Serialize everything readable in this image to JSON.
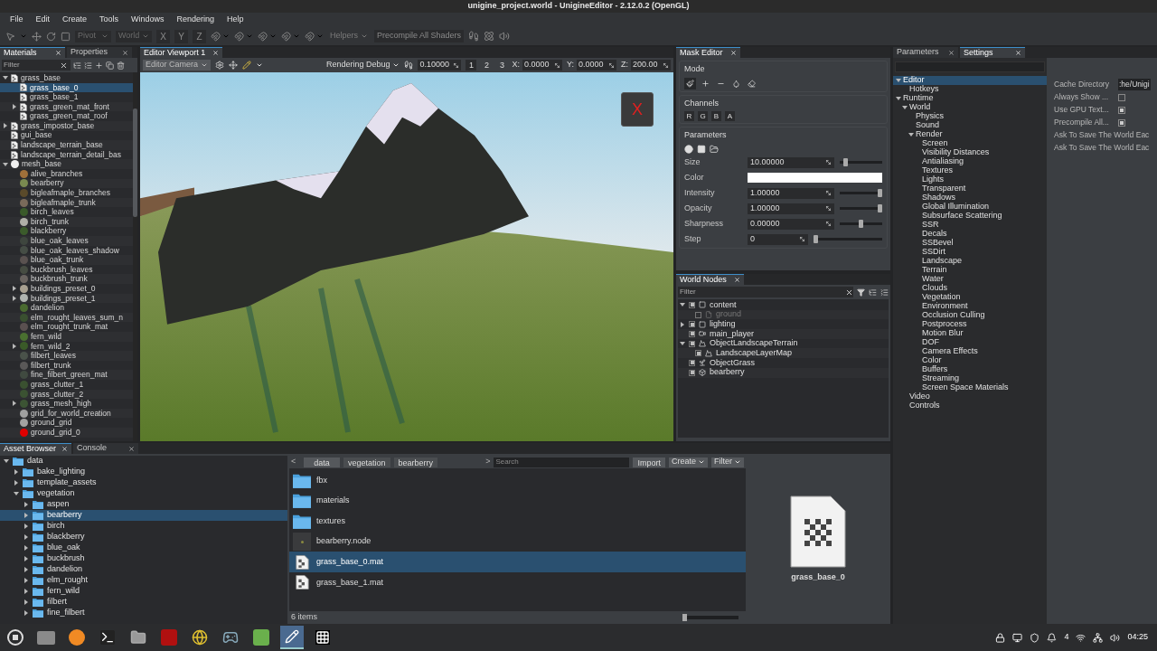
{
  "window": {
    "title": "unigine_project.world - UnigineEditor - 2.12.0.2 (OpenGL)"
  },
  "menu": [
    "File",
    "Edit",
    "Create",
    "Tools",
    "Windows",
    "Rendering",
    "Help"
  ],
  "toolbar": {
    "pivot": "Pivot",
    "space": "World",
    "axes": [
      "X",
      "Y",
      "Z"
    ],
    "helpers": "Helpers",
    "precompile": "Precompile All Shaders"
  },
  "materials": {
    "tabs": [
      {
        "label": "Materials",
        "selected": true
      },
      {
        "label": "Properties",
        "selected": false
      }
    ],
    "filter_placeholder": "Filter",
    "items": [
      {
        "label": "grass_base",
        "kind": "doc",
        "selected": false,
        "expanded": true,
        "children": [
          {
            "label": "grass_base_0",
            "kind": "doc",
            "selected": true
          },
          {
            "label": "grass_base_1",
            "kind": "doc",
            "selected": false
          },
          {
            "label": "grass_green_mat_front",
            "kind": "doc",
            "selected": false,
            "expanded": false
          },
          {
            "label": "grass_green_mat_roof",
            "kind": "doc",
            "selected": false
          }
        ]
      },
      {
        "label": "grass_impostor_base",
        "kind": "doc",
        "selected": false,
        "expanded": false
      },
      {
        "label": "gui_base",
        "kind": "doc",
        "selected": false
      },
      {
        "label": "landscape_terrain_base",
        "kind": "doc",
        "selected": false
      },
      {
        "label": "landscape_terrain_detail_bas",
        "kind": "doc",
        "selected": false
      },
      {
        "label": "mesh_base",
        "kind": "sphere",
        "color": "#f0f0f0",
        "selected": false,
        "expanded": true,
        "children": [
          {
            "label": "alive_branches",
            "kind": "sphere",
            "color": "#a0703a",
            "selected": false
          },
          {
            "label": "bearberry",
            "kind": "sphere",
            "color": "#7a8a50",
            "selected": false
          },
          {
            "label": "bigleafmaple_branches",
            "kind": "sphere",
            "color": "#5a4a2a",
            "selected": false
          },
          {
            "label": "bigleafmaple_trunk",
            "kind": "sphere",
            "color": "#7a6a5a",
            "selected": false
          },
          {
            "label": "birch_leaves",
            "kind": "sphere",
            "color": "#3a5a2a",
            "selected": false
          },
          {
            "label": "birch_trunk",
            "kind": "sphere",
            "color": "#b0b0a8",
            "selected": false
          },
          {
            "label": "blackberry",
            "kind": "sphere",
            "color": "#3b5b2b",
            "selected": false
          },
          {
            "label": "blue_oak_leaves",
            "kind": "sphere",
            "color": "#3e463e",
            "selected": false
          },
          {
            "label": "blue_oak_leaves_shadow",
            "kind": "sphere",
            "color": "#454d45",
            "selected": false
          },
          {
            "label": "blue_oak_trunk",
            "kind": "sphere",
            "color": "#5a5250",
            "selected": false
          },
          {
            "label": "buckbrush_leaves",
            "kind": "sphere",
            "color": "#464c42",
            "selected": false
          },
          {
            "label": "buckbrush_trunk",
            "kind": "sphere",
            "color": "#6a6460",
            "selected": false
          },
          {
            "label": "buildings_preset_0",
            "kind": "sphere",
            "color": "#a8a090",
            "selected": false,
            "expanded": false
          },
          {
            "label": "buildings_preset_1",
            "kind": "sphere",
            "color": "#b0b4b0",
            "selected": false,
            "expanded": false
          },
          {
            "label": "dandelion",
            "kind": "sphere",
            "color": "#4a6a30",
            "selected": false
          },
          {
            "label": "elm_rought_leaves_sum_n",
            "kind": "sphere",
            "color": "#3a5030",
            "selected": false
          },
          {
            "label": "elm_rought_trunk_mat",
            "kind": "sphere",
            "color": "#5a5050",
            "selected": false
          },
          {
            "label": "fern_wild",
            "kind": "sphere",
            "color": "#4a7030",
            "selected": false
          },
          {
            "label": "fern_wild_2",
            "kind": "sphere",
            "color": "#3a5a28",
            "selected": false,
            "expanded": false
          },
          {
            "label": "filbert_leaves",
            "kind": "sphere",
            "color": "#4a524a",
            "selected": false
          },
          {
            "label": "filbert_trunk",
            "kind": "sphere",
            "color": "#5a5858",
            "selected": false
          },
          {
            "label": "fine_filbert_green_mat",
            "kind": "sphere",
            "color": "#404a40",
            "selected": false
          },
          {
            "label": "grass_clutter_1",
            "kind": "sphere",
            "color": "#3a5030",
            "selected": false
          },
          {
            "label": "grass_clutter_2",
            "kind": "sphere",
            "color": "#3b5232",
            "selected": false
          },
          {
            "label": "grass_mesh_high",
            "kind": "sphere",
            "color": "#3c5434",
            "selected": false,
            "expanded": false
          },
          {
            "label": "grid_for_world_creation",
            "kind": "sphere",
            "color": "#a0a0a0",
            "selected": false
          },
          {
            "label": "ground_grid",
            "kind": "sphere",
            "color": "#a2a2a2",
            "selected": false
          },
          {
            "label": "ground_grid_0",
            "kind": "sphere",
            "color": "#e00000",
            "selected": false
          }
        ]
      }
    ]
  },
  "viewport": {
    "tab": "Editor Viewport 1",
    "camera": "Editor Camera",
    "rendering": "Rendering Debug",
    "speed": "0.10000",
    "presets": [
      "1",
      "2",
      "3"
    ],
    "coords": [
      {
        "label": "X:",
        "value": "0.0000"
      },
      {
        "label": "Y:",
        "value": "0.0000"
      },
      {
        "label": "Z:",
        "value": "200.00"
      }
    ],
    "gizmo_label": "X"
  },
  "mask_editor": {
    "tab": "Mask Editor",
    "mode_title": "Mode",
    "modes": [
      {
        "kind": "brush",
        "selected": true
      },
      {
        "kind": "add",
        "selected": false
      },
      {
        "kind": "subtract",
        "selected": false
      },
      {
        "kind": "drop",
        "selected": false
      },
      {
        "kind": "eraser",
        "selected": false
      }
    ],
    "channels_title": "Channels",
    "channels": [
      "R",
      "G",
      "B",
      "A"
    ],
    "parameters_title": "Parameters",
    "params": [
      {
        "kind": "number",
        "label": "Size",
        "value": "10.00000",
        "level": 0.1
      },
      {
        "kind": "color",
        "label": "Color",
        "color": "#ffffff"
      },
      {
        "kind": "number",
        "label": "Intensity",
        "value": "1.00000",
        "level": 1
      },
      {
        "kind": "number",
        "label": "Opacity",
        "value": "1.00000",
        "level": 1
      },
      {
        "kind": "number",
        "label": "Sharpness",
        "value": "0.00000",
        "level": 0.5
      },
      {
        "kind": "integer",
        "label": "Step",
        "value": "0",
        "level": 0
      }
    ]
  },
  "world_nodes": {
    "tab": "World Nodes",
    "filter_placeholder": "Filter",
    "items": [
      {
        "label": "content",
        "kind": "dummy",
        "checked": true,
        "disabled": false,
        "expanded": true,
        "children": [
          {
            "label": "ground",
            "kind": "file",
            "checked": false,
            "disabled": true
          }
        ]
      },
      {
        "label": "lighting",
        "kind": "dummy",
        "checked": true,
        "disabled": false,
        "expanded": false
      },
      {
        "label": "main_player",
        "kind": "player",
        "checked": true,
        "disabled": false
      },
      {
        "label": "ObjectLandscapeTerrain",
        "kind": "terrain",
        "checked": true,
        "disabled": false,
        "expanded": true,
        "children": [
          {
            "label": "LandscapeLayerMap",
            "kind": "terrain",
            "checked": true,
            "disabled": false
          }
        ]
      },
      {
        "label": "ObjectGrass",
        "kind": "grass",
        "checked": true,
        "disabled": false
      },
      {
        "label": "bearberry",
        "kind": "mesh",
        "checked": true,
        "disabled": false
      }
    ]
  },
  "settings": {
    "tabs": [
      {
        "label": "Parameters",
        "selected": false
      },
      {
        "label": "Settings",
        "selected": true
      }
    ],
    "tree": [
      {
        "label": "Editor",
        "selected": true,
        "expanded": true,
        "children": [
          {
            "label": "Hotkeys",
            "selected": false
          }
        ]
      },
      {
        "label": "Runtime",
        "selected": false,
        "expanded": true,
        "children": [
          {
            "label": "World",
            "selected": false,
            "expanded": true,
            "children": [
              {
                "label": "Physics",
                "selected": false
              },
              {
                "label": "Sound",
                "selected": false
              },
              {
                "label": "Render",
                "selected": false,
                "expanded": true,
                "children": [
                  {
                    "label": "Screen",
                    "selected": false
                  },
                  {
                    "label": "Visibility Distances",
                    "selected": false
                  },
                  {
                    "label": "Antialiasing",
                    "selected": false
                  },
                  {
                    "label": "Textures",
                    "selected": false
                  },
                  {
                    "label": "Lights",
                    "selected": false
                  },
                  {
                    "label": "Transparent",
                    "selected": false
                  },
                  {
                    "label": "Shadows",
                    "selected": false
                  },
                  {
                    "label": "Global Illumination",
                    "selected": false
                  },
                  {
                    "label": "Subsurface Scattering",
                    "selected": false
                  },
                  {
                    "label": "SSR",
                    "selected": false
                  },
                  {
                    "label": "Decals",
                    "selected": false
                  },
                  {
                    "label": "SSBevel",
                    "selected": false
                  },
                  {
                    "label": "SSDirt",
                    "selected": false
                  },
                  {
                    "label": "Landscape",
                    "selected": false
                  },
                  {
                    "label": "Terrain",
                    "selected": false
                  },
                  {
                    "label": "Water",
                    "selected": false
                  },
                  {
                    "label": "Clouds",
                    "selected": false
                  },
                  {
                    "label": "Vegetation",
                    "selected": false
                  },
                  {
                    "label": "Environment",
                    "selected": false
                  },
                  {
                    "label": "Occlusion Culling",
                    "selected": false
                  },
                  {
                    "label": "Postprocess",
                    "selected": false
                  },
                  {
                    "label": "Motion Blur",
                    "selected": false
                  },
                  {
                    "label": "DOF",
                    "selected": false
                  },
                  {
                    "label": "Camera Effects",
                    "selected": false
                  },
                  {
                    "label": "Color",
                    "selected": false
                  },
                  {
                    "label": "Buffers",
                    "selected": false
                  },
                  {
                    "label": "Streaming",
                    "selected": false
                  },
                  {
                    "label": "Screen Space Materials",
                    "selected": false
                  }
                ]
              }
            ]
          },
          {
            "label": "Video",
            "selected": false
          },
          {
            "label": "Controls",
            "selected": false
          }
        ]
      }
    ],
    "props": [
      {
        "kind": "text",
        "label": "Cache Directory",
        "value": ":he/Unigi"
      },
      {
        "kind": "checkbox",
        "label": "Always Show ...",
        "checked": false
      },
      {
        "kind": "checkbox",
        "label": "Use GPU Text...",
        "checked": true
      },
      {
        "kind": "checkbox",
        "label": "Precompile All...",
        "checked": true
      },
      {
        "kind": "label",
        "label": "Ask To Save The World Eac"
      },
      {
        "kind": "label",
        "label": "Ask To Save The World Eac"
      }
    ]
  },
  "asset_browser": {
    "tabs": [
      {
        "label": "Asset Browser",
        "selected": true
      },
      {
        "label": "Console",
        "selected": false
      }
    ],
    "tree": [
      {
        "label": "data",
        "selected": false,
        "expanded": true,
        "children": [
          {
            "label": "bake_lighting",
            "selected": false,
            "expanded": false
          },
          {
            "label": "template_assets",
            "selected": false,
            "expanded": false
          },
          {
            "label": "vegetation",
            "selected": false,
            "expanded": true,
            "children": [
              {
                "label": "aspen",
                "selected": false,
                "expanded": false
              },
              {
                "label": "bearberry",
                "selected": true,
                "expanded": false
              },
              {
                "label": "birch",
                "selected": false,
                "expanded": false
              },
              {
                "label": "blackberry",
                "selected": false,
                "expanded": false
              },
              {
                "label": "blue_oak",
                "selected": false,
                "expanded": false
              },
              {
                "label": "buckbrush",
                "selected": false,
                "expanded": false
              },
              {
                "label": "dandelion",
                "selected": false,
                "expanded": false
              },
              {
                "label": "elm_rought",
                "selected": false,
                "expanded": false
              },
              {
                "label": "fern_wild",
                "selected": false,
                "expanded": false
              },
              {
                "label": "filbert",
                "selected": false,
                "expanded": false
              },
              {
                "label": "fine_filbert",
                "selected": false,
                "expanded": false
              }
            ]
          }
        ]
      }
    ],
    "back": "<",
    "forward": ">",
    "breadcrumbs": [
      "data",
      "vegetation",
      "bearberry"
    ],
    "search_placeholder": "Search",
    "import": "Import",
    "create": "Create",
    "filter": "Filter",
    "files": [
      {
        "kind": "folder",
        "label": "fbx",
        "selected": false
      },
      {
        "kind": "folder",
        "label": "materials",
        "selected": false
      },
      {
        "kind": "folder",
        "label": "textures",
        "selected": false
      },
      {
        "kind": "node",
        "label": "bearberry.node",
        "selected": false
      },
      {
        "kind": "material",
        "label": "grass_base_0.mat",
        "selected": true
      },
      {
        "kind": "material",
        "label": "grass_base_1.mat",
        "selected": false
      }
    ],
    "status": "6 items",
    "zoom": {
      "level": 0
    },
    "preview_label": "grass_base_0"
  },
  "taskbar": {
    "apps": [
      {
        "kind": "start",
        "selected": false
      },
      {
        "kind": "window",
        "selected": false
      },
      {
        "kind": "browser",
        "selected": false
      },
      {
        "kind": "terminal",
        "selected": false
      },
      {
        "kind": "folder",
        "selected": false
      },
      {
        "kind": "ftp",
        "selected": false
      },
      {
        "kind": "chrome",
        "selected": false
      },
      {
        "kind": "steam",
        "selected": false
      },
      {
        "kind": "files",
        "selected": false
      },
      {
        "kind": "editor",
        "selected": true
      },
      {
        "kind": "dots",
        "selected": false
      }
    ],
    "tray_count": "4",
    "clock": "04:25"
  }
}
